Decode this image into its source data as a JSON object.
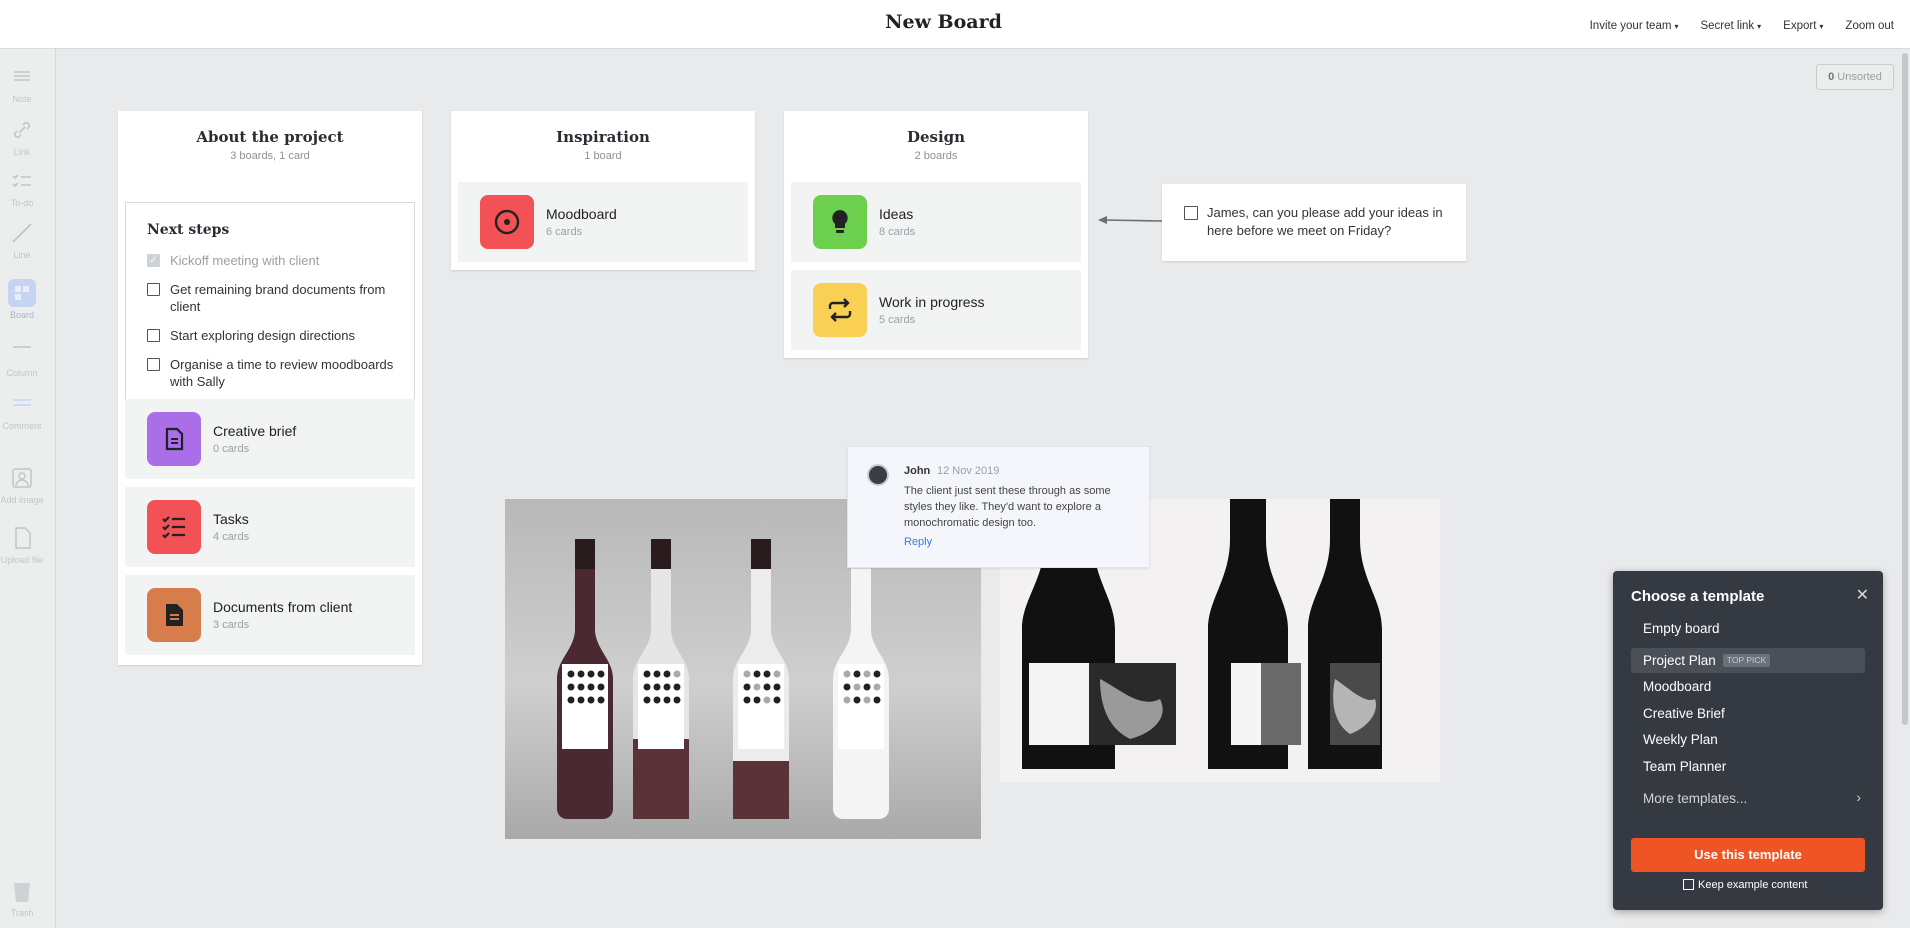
{
  "header": {
    "title": "New Board",
    "nav": [
      "Invite your team",
      "Secret link",
      "Export",
      "Zoom out"
    ]
  },
  "sidebar": {
    "tools": [
      "Note",
      "Link",
      "To-do",
      "Line",
      "Board",
      "Column",
      "Comment",
      "Add image",
      "Upload file"
    ],
    "trash": "Trash"
  },
  "unsorted": {
    "count": "0",
    "label": "Unsorted"
  },
  "about": {
    "title": "About the project",
    "subtitle": "3 boards, 1 card",
    "todo": {
      "title": "Next steps",
      "items": [
        {
          "text": "Kickoff meeting with client",
          "done": true
        },
        {
          "text": "Get remaining brand documents from client",
          "done": false
        },
        {
          "text": "Start exploring design directions",
          "done": false
        },
        {
          "text": "Organise a time to review moodboards with Sally",
          "done": false
        }
      ]
    },
    "boards": [
      {
        "name": "Creative brief",
        "count": "0 cards",
        "color": "#a96ee8",
        "icon": "document-icon"
      },
      {
        "name": "Tasks",
        "count": "4 cards",
        "color": "#f25255",
        "icon": "checklist-icon"
      },
      {
        "name": "Documents from client",
        "count": "3 cards",
        "color": "#d67d4b",
        "icon": "file-icon"
      }
    ]
  },
  "inspiration": {
    "title": "Inspiration",
    "subtitle": "1 board",
    "boards": [
      {
        "name": "Moodboard",
        "count": "6 cards",
        "color": "#f25255",
        "icon": "target-icon"
      }
    ]
  },
  "design": {
    "title": "Design",
    "subtitle": "2 boards",
    "boards": [
      {
        "name": "Ideas",
        "count": "8 cards",
        "color": "#6ccf4e",
        "icon": "lightbulb-icon"
      },
      {
        "name": "Work in progress",
        "count": "5 cards",
        "color": "#fad054",
        "icon": "repeat-icon"
      }
    ]
  },
  "note": {
    "text": "James, can you please add your ideas in here before we meet on Friday?"
  },
  "comment": {
    "author": "John",
    "date": "12 Nov 2019",
    "body": "The client just sent these through as some styles they like. They'd want to explore a monochromatic design too.",
    "reply": "Reply"
  },
  "template_panel": {
    "title": "Choose a template",
    "items": [
      "Empty board",
      "Project Plan",
      "Moodboard",
      "Creative Brief",
      "Weekly Plan",
      "Team Planner"
    ],
    "selected_badge": "TOP PICK",
    "more": "More templates...",
    "button": "Use this template",
    "keep_label": "Keep example content"
  },
  "colors": {
    "accent": "#ef5424",
    "panel_bg": "#353a42",
    "canvas_bg": "#e9eaeb"
  }
}
